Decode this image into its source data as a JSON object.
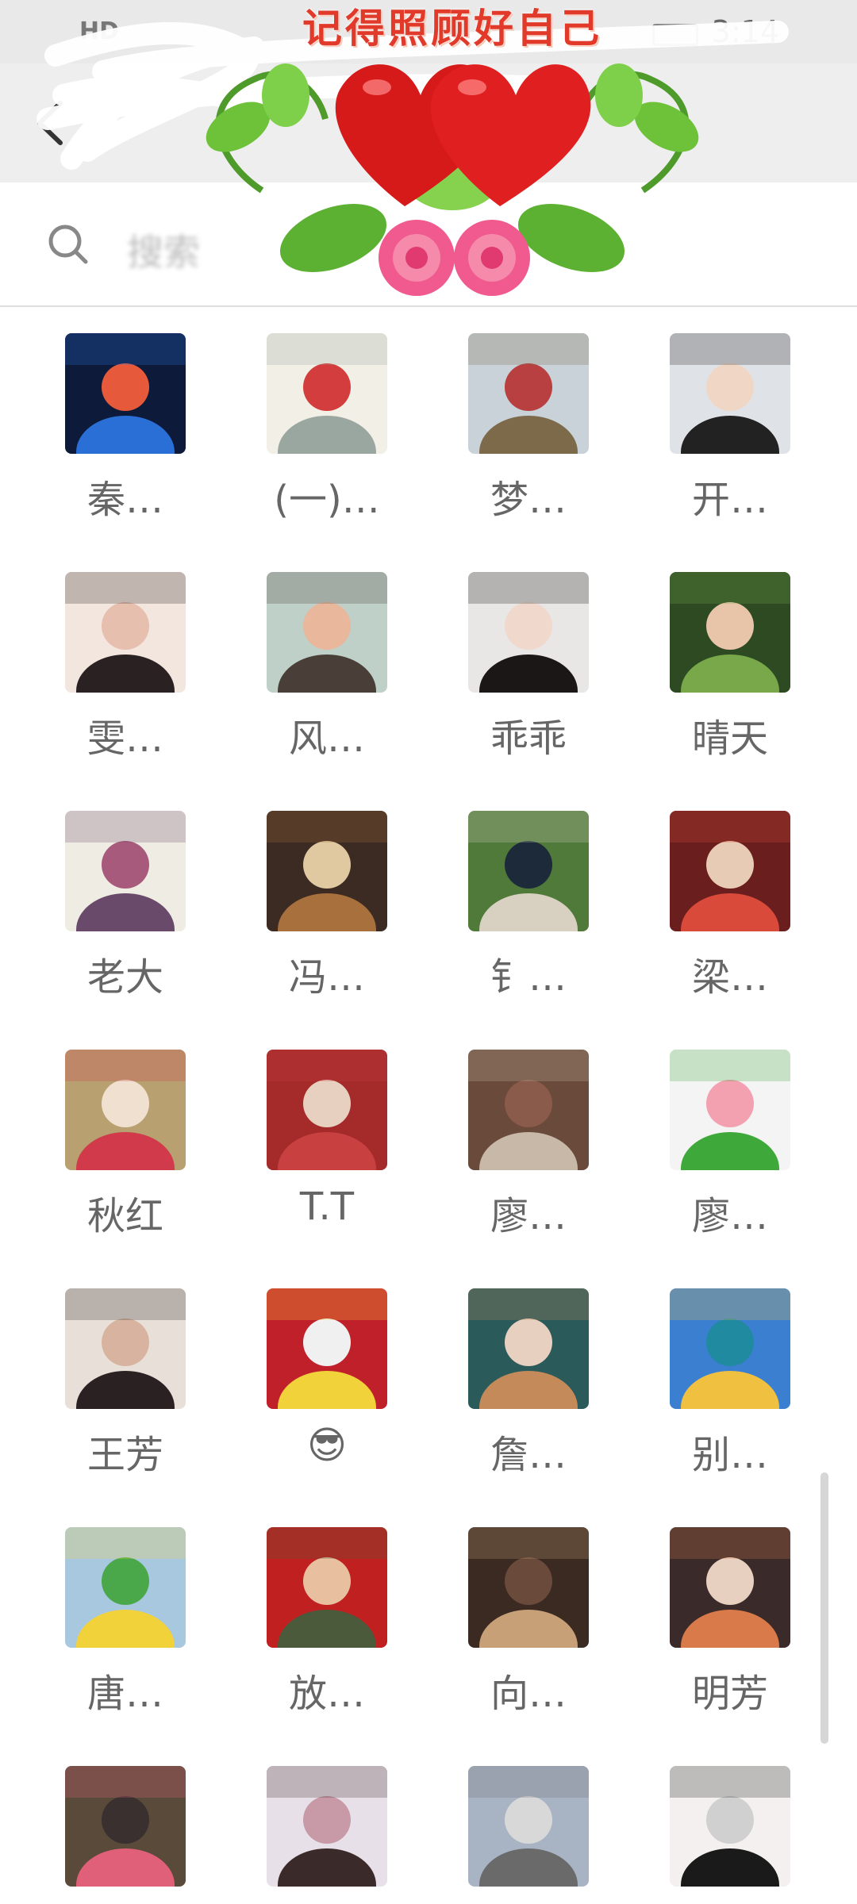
{
  "status_bar": {
    "signal_text": "HD",
    "time": "3:14"
  },
  "title_bar": {
    "back_label": "back"
  },
  "search": {
    "text": "搜索"
  },
  "sticker": {
    "caption": "记得照顾好自己"
  },
  "members": [
    {
      "name": "秦…",
      "palette": [
        "#0d1a3a",
        "#2a6fd6",
        "#e65a3b"
      ]
    },
    {
      "name": "(一)…",
      "palette": [
        "#f2efe6",
        "#9aa7a0",
        "#d43d3d"
      ]
    },
    {
      "name": "梦…",
      "palette": [
        "#c9d2d8",
        "#7c6a4a",
        "#b84040"
      ]
    },
    {
      "name": "开…",
      "palette": [
        "#dfe2e6",
        "#222222",
        "#f0d6c4"
      ]
    },
    {
      "name": "雯…",
      "palette": [
        "#f3e6de",
        "#2a2222",
        "#e6bfae"
      ]
    },
    {
      "name": "风…",
      "palette": [
        "#bfd0c8",
        "#4a3f38",
        "#e8b79c"
      ]
    },
    {
      "name": "乖乖",
      "palette": [
        "#e9e6e6",
        "#1b1716",
        "#f0d8cc"
      ]
    },
    {
      "name": "晴天",
      "palette": [
        "#2d4a22",
        "#79a84a",
        "#e8c4a8"
      ]
    },
    {
      "name": "老大",
      "palette": [
        "#efece4",
        "#6a4a6a",
        "#a85a7c"
      ]
    },
    {
      "name": "冯…",
      "palette": [
        "#3b2b22",
        "#a8703c",
        "#e0c8a0"
      ]
    },
    {
      "name": "钅…",
      "palette": [
        "#4f7a3a",
        "#d8d0c0",
        "#1d2a3a"
      ]
    },
    {
      "name": "梁…",
      "palette": [
        "#6a1e1e",
        "#d94a3a",
        "#e8cbb4"
      ]
    },
    {
      "name": "秋红",
      "palette": [
        "#b8a070",
        "#d03a4a",
        "#f0e0d0"
      ]
    },
    {
      "name": "T.T",
      "palette": [
        "#a52a2a",
        "#c84040",
        "#e8d0c0"
      ]
    },
    {
      "name": "廖…",
      "palette": [
        "#6a4a3a",
        "#c8b8a8",
        "#8a5a4a"
      ]
    },
    {
      "name": "廖…",
      "palette": [
        "#f4f4f4",
        "#3ea83a",
        "#f3a0b0"
      ]
    },
    {
      "name": "王芳",
      "palette": [
        "#e8e0d8",
        "#2a2222",
        "#d8b4a0"
      ]
    },
    {
      "name": "😎",
      "palette": [
        "#c0202a",
        "#f2d23a",
        "#f0f0f0"
      ]
    },
    {
      "name": "詹…",
      "palette": [
        "#2a5a5a",
        "#c48a5a",
        "#e8d0c0"
      ]
    },
    {
      "name": "别…",
      "palette": [
        "#3b7fd0",
        "#f0c040",
        "#1f8aa0"
      ]
    },
    {
      "name": "唐…",
      "palette": [
        "#a8c8e0",
        "#f2d23a",
        "#4aa84a"
      ]
    },
    {
      "name": "放…",
      "palette": [
        "#c02020",
        "#4a5a3a",
        "#e8c0a0"
      ]
    },
    {
      "name": "向…",
      "palette": [
        "#3a2a22",
        "#c8a078",
        "#6a4a3a"
      ]
    },
    {
      "name": "明芳",
      "palette": [
        "#3a2a2a",
        "#d87a4a",
        "#e8d0c0"
      ]
    },
    {
      "name": "",
      "palette": [
        "#5a4a3a",
        "#e0607a",
        "#3a3030"
      ]
    },
    {
      "name": "",
      "palette": [
        "#e8e0e8",
        "#3a2a2a",
        "#c89aa8"
      ]
    },
    {
      "name": "",
      "palette": [
        "#a8b4c4",
        "#6a6a6a",
        "#d8d8d8"
      ]
    },
    {
      "name": "",
      "palette": [
        "#f4f0f0",
        "#1a1a1a",
        "#d0d0d0"
      ]
    }
  ]
}
